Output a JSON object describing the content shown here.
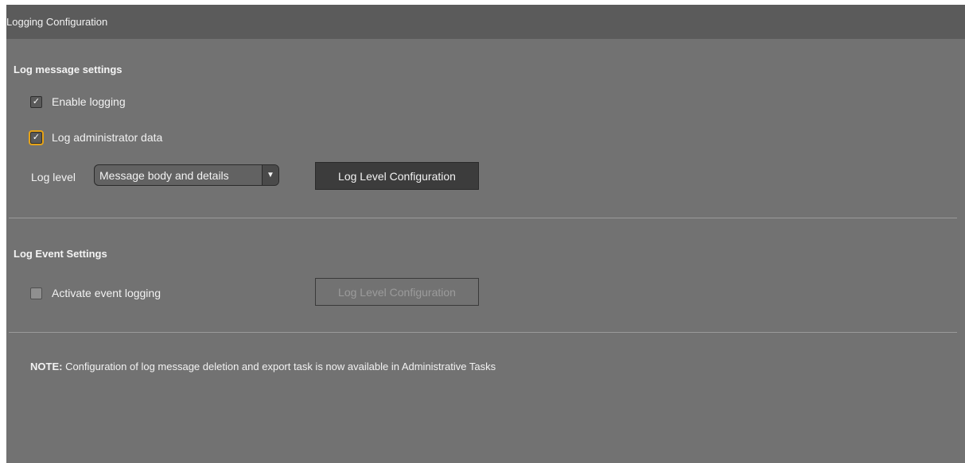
{
  "panel": {
    "title": "Logging Configuration"
  },
  "log_message_settings": {
    "heading": "Log message settings",
    "enable_logging": {
      "label": "Enable logging",
      "checked": true
    },
    "log_admin_data": {
      "label": "Log administrator data",
      "checked": true,
      "focused": true
    },
    "log_level": {
      "label": "Log level",
      "selected": "Message body and details"
    },
    "config_button_label": "Log Level Configuration"
  },
  "log_event_settings": {
    "heading": "Log Event Settings",
    "activate_event_logging": {
      "label": "Activate event logging",
      "checked": false
    },
    "config_button_label": "Log Level Configuration",
    "config_button_enabled": false
  },
  "note": {
    "prefix": "NOTE:",
    "text": " Configuration of log message deletion and export task is now available in Administrative Tasks"
  },
  "icons": {
    "checkmark": "check-icon",
    "dropdown_arrow": "dropdown-arrow-icon"
  },
  "colors": {
    "panel_bg": "#727272",
    "header_bg": "#5b5b5b",
    "button_bg": "#3c3c3c",
    "focus_outline": "#e6a317"
  }
}
